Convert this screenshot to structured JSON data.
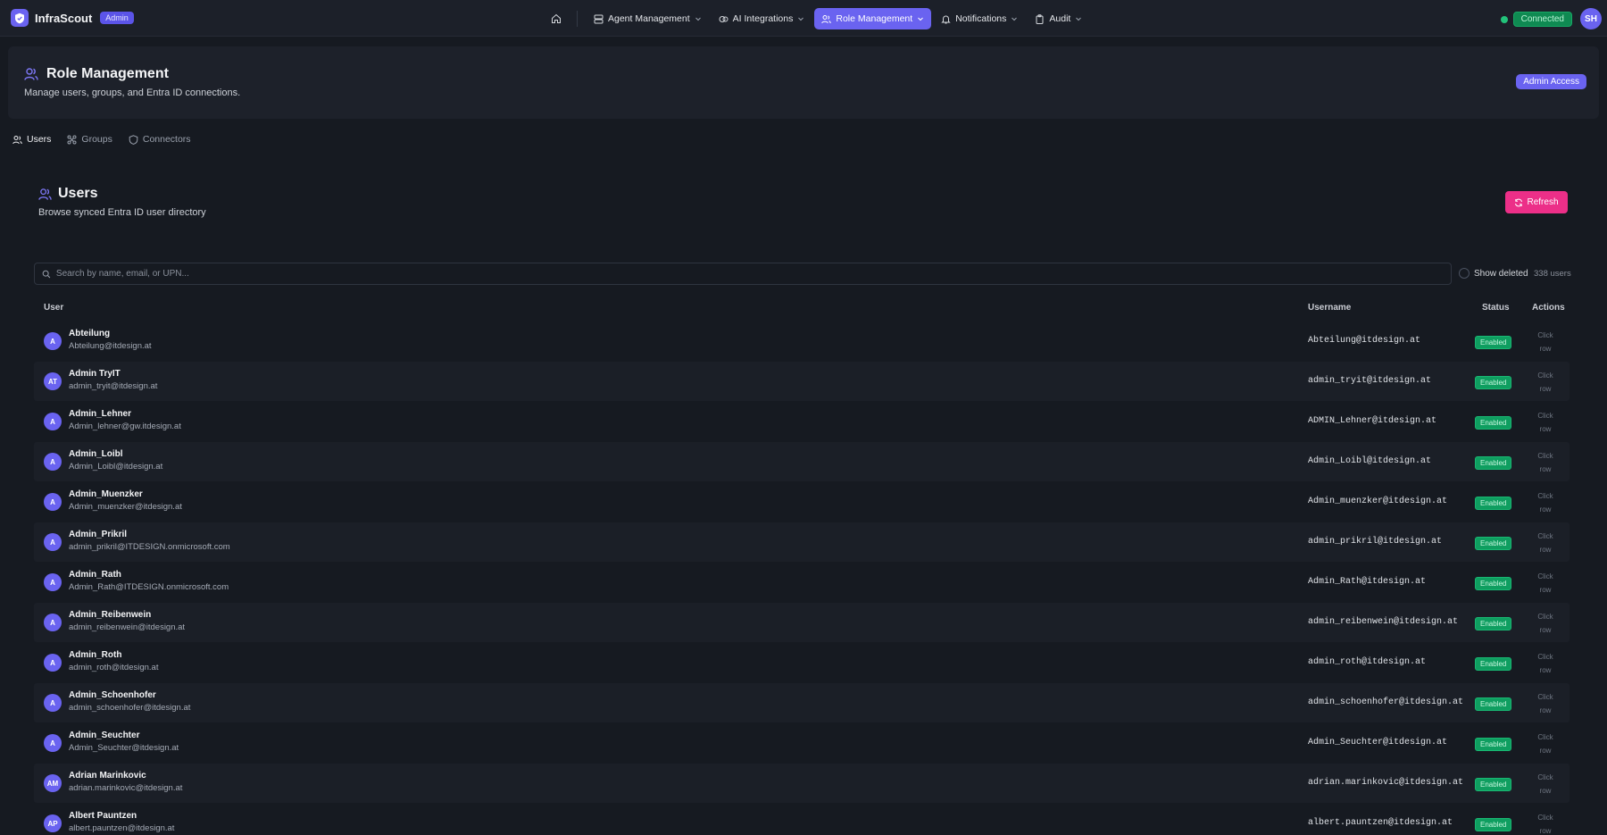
{
  "app": {
    "name": "InfraScout",
    "role_badge": "Admin"
  },
  "nav": {
    "items": [
      {
        "label": "Agent Management"
      },
      {
        "label": "AI Integrations"
      },
      {
        "label": "Role Management"
      },
      {
        "label": "Notifications"
      },
      {
        "label": "Audit"
      }
    ],
    "active_index": 2
  },
  "connection": {
    "status": "Connected"
  },
  "current_user": {
    "initials": "SH"
  },
  "page": {
    "title": "Role Management",
    "subtitle": "Manage users, groups, and Entra ID connections.",
    "access_badge": "Admin Access"
  },
  "tabs": [
    {
      "label": "Users"
    },
    {
      "label": "Groups"
    },
    {
      "label": "Connectors"
    }
  ],
  "users_section": {
    "title": "Users",
    "subtitle": "Browse synced Entra ID user directory",
    "refresh_label": "Refresh",
    "search_placeholder": "Search by name, email, or UPN...",
    "show_deleted_label": "Show deleted",
    "count_label": "338 users"
  },
  "table": {
    "headers": {
      "user": "User",
      "username": "Username",
      "status": "Status",
      "actions": "Actions"
    },
    "action_line1": "Click",
    "action_line2": "row",
    "rows": [
      {
        "initials": "A",
        "name": "Abteilung",
        "email": "Abteilung@itdesign.at",
        "username": "Abteilung@itdesign.at",
        "status": "Enabled"
      },
      {
        "initials": "AT",
        "name": "Admin TryIT",
        "email": "admin_tryit@itdesign.at",
        "username": "admin_tryit@itdesign.at",
        "status": "Enabled"
      },
      {
        "initials": "A",
        "name": "Admin_Lehner",
        "email": "Admin_lehner@gw.itdesign.at",
        "username": "ADMIN_Lehner@itdesign.at",
        "status": "Enabled"
      },
      {
        "initials": "A",
        "name": "Admin_Loibl",
        "email": "Admin_Loibl@itdesign.at",
        "username": "Admin_Loibl@itdesign.at",
        "status": "Enabled"
      },
      {
        "initials": "A",
        "name": "Admin_Muenzker",
        "email": "Admin_muenzker@itdesign.at",
        "username": "Admin_muenzker@itdesign.at",
        "status": "Enabled"
      },
      {
        "initials": "A",
        "name": "Admin_Prikril",
        "email": "admin_prikril@ITDESIGN.onmicrosoft.com",
        "username": "admin_prikril@itdesign.at",
        "status": "Enabled"
      },
      {
        "initials": "A",
        "name": "Admin_Rath",
        "email": "Admin_Rath@ITDESIGN.onmicrosoft.com",
        "username": "Admin_Rath@itdesign.at",
        "status": "Enabled"
      },
      {
        "initials": "A",
        "name": "Admin_Reibenwein",
        "email": "admin_reibenwein@itdesign.at",
        "username": "admin_reibenwein@itdesign.at",
        "status": "Enabled"
      },
      {
        "initials": "A",
        "name": "Admin_Roth",
        "email": "admin_roth@itdesign.at",
        "username": "admin_roth@itdesign.at",
        "status": "Enabled"
      },
      {
        "initials": "A",
        "name": "Admin_Schoenhofer",
        "email": "admin_schoenhofer@itdesign.at",
        "username": "admin_schoenhofer@itdesign.at",
        "status": "Enabled"
      },
      {
        "initials": "A",
        "name": "Admin_Seuchter",
        "email": "Admin_Seuchter@itdesign.at",
        "username": "Admin_Seuchter@itdesign.at",
        "status": "Enabled"
      },
      {
        "initials": "AM",
        "name": "Adrian Marinkovic",
        "email": "adrian.marinkovic@itdesign.at",
        "username": "adrian.marinkovic@itdesign.at",
        "status": "Enabled"
      },
      {
        "initials": "AP",
        "name": "Albert Pauntzen",
        "email": "albert.pauntzen@itdesign.at",
        "username": "albert.pauntzen@itdesign.at",
        "status": "Enabled"
      }
    ]
  },
  "colors": {
    "background": "#161a21",
    "surface": "#1d212a",
    "accent": "#6a63f0",
    "refresh": "#ec2f88",
    "enabled": "#0f9e60"
  }
}
